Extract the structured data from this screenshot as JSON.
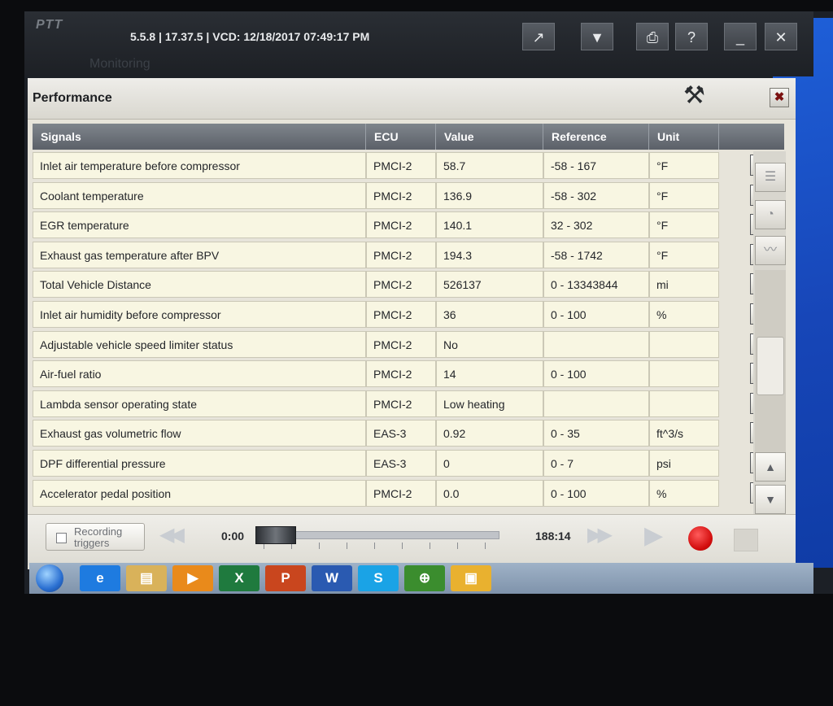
{
  "app": {
    "title": "5.5.8 | 17.37.5 | VCD: 12/18/2017 07:49:17 PM",
    "logo_text": "PTT",
    "ghost_tab": "Monitoring"
  },
  "titlebar_buttons": [
    {
      "name": "forward-icon",
      "glyph": "↗"
    },
    {
      "name": "dropdown-icon",
      "glyph": "▼"
    },
    {
      "name": "print-icon",
      "glyph": "⎙"
    },
    {
      "name": "help-icon",
      "glyph": "?"
    },
    {
      "name": "minimize-icon",
      "glyph": "_"
    },
    {
      "name": "close-icon",
      "glyph": "✕"
    }
  ],
  "window": {
    "title": "Performance",
    "close_glyph": "✖",
    "tools_glyph": "⚒"
  },
  "table": {
    "headers": {
      "signals": "Signals",
      "ecu": "ECU",
      "value": "Value",
      "reference": "Reference",
      "unit": "Unit"
    },
    "info_glyph": "i",
    "rows": [
      {
        "signal": "Inlet air temperature before compressor",
        "ecu": "PMCI-2",
        "value": "58.7",
        "reference": "-58 - 167",
        "unit": "°F"
      },
      {
        "signal": "Coolant temperature",
        "ecu": "PMCI-2",
        "value": "136.9",
        "reference": "-58 - 302",
        "unit": "°F"
      },
      {
        "signal": "EGR temperature",
        "ecu": "PMCI-2",
        "value": "140.1",
        "reference": "32 - 302",
        "unit": "°F"
      },
      {
        "signal": "Exhaust gas temperature after BPV",
        "ecu": "PMCI-2",
        "value": "194.3",
        "reference": "-58 - 1742",
        "unit": "°F"
      },
      {
        "signal": "Total Vehicle Distance",
        "ecu": "PMCI-2",
        "value": "526137",
        "reference": "0 - 13343844",
        "unit": "mi"
      },
      {
        "signal": "Inlet air humidity before compressor",
        "ecu": "PMCI-2",
        "value": "36",
        "reference": "0 - 100",
        "unit": "%"
      },
      {
        "signal": "Adjustable vehicle speed limiter status",
        "ecu": "PMCI-2",
        "value": "No",
        "reference": "",
        "unit": ""
      },
      {
        "signal": "Air-fuel ratio",
        "ecu": "PMCI-2",
        "value": "14",
        "reference": "0 - 100",
        "unit": ""
      },
      {
        "signal": "Lambda sensor operating state",
        "ecu": "PMCI-2",
        "value": "Low heating",
        "reference": "",
        "unit": ""
      },
      {
        "signal": "Exhaust gas volumetric flow",
        "ecu": "EAS-3",
        "value": "0.92",
        "reference": "0 - 35",
        "unit": "ft^3/s"
      },
      {
        "signal": "DPF differential pressure",
        "ecu": "EAS-3",
        "value": "0",
        "reference": "0 - 7",
        "unit": "psi"
      },
      {
        "signal": "Accelerator pedal position",
        "ecu": "PMCI-2",
        "value": "0.0",
        "reference": "0 - 100",
        "unit": "%"
      }
    ]
  },
  "side_tools": [
    {
      "name": "list-view-icon",
      "glyph": "☰"
    },
    {
      "name": "gauge-view-icon",
      "glyph": "◔"
    },
    {
      "name": "graph-view-icon",
      "glyph": "〰"
    }
  ],
  "scroll": {
    "up_glyph": "▲",
    "down_glyph": "▼"
  },
  "playback": {
    "recording_triggers_label": "Recording triggers",
    "current_time": "0:00",
    "total_time": "188:14",
    "rewind_glyph": "◀◀",
    "fast_forward_glyph": "▶▶",
    "play_glyph": "▶",
    "position_fraction": 0.0
  },
  "taskbar": [
    {
      "name": "internet-explorer-icon",
      "glyph": "e",
      "color": "#1e7be0"
    },
    {
      "name": "file-explorer-icon",
      "glyph": "▤",
      "color": "#d9b25a"
    },
    {
      "name": "media-player-icon",
      "glyph": "▶",
      "color": "#e98a1b"
    },
    {
      "name": "excel-icon",
      "glyph": "X",
      "color": "#1f7a3e"
    },
    {
      "name": "powerpoint-icon",
      "glyph": "P",
      "color": "#c9461e"
    },
    {
      "name": "word-icon",
      "glyph": "W",
      "color": "#2a5ab1"
    },
    {
      "name": "skype-icon",
      "glyph": "S",
      "color": "#1aa3e6"
    },
    {
      "name": "magnifier-icon",
      "glyph": "⊕",
      "color": "#3b8d2e"
    },
    {
      "name": "diagnostic-app-icon",
      "glyph": "▣",
      "color": "#e9b12f"
    }
  ]
}
